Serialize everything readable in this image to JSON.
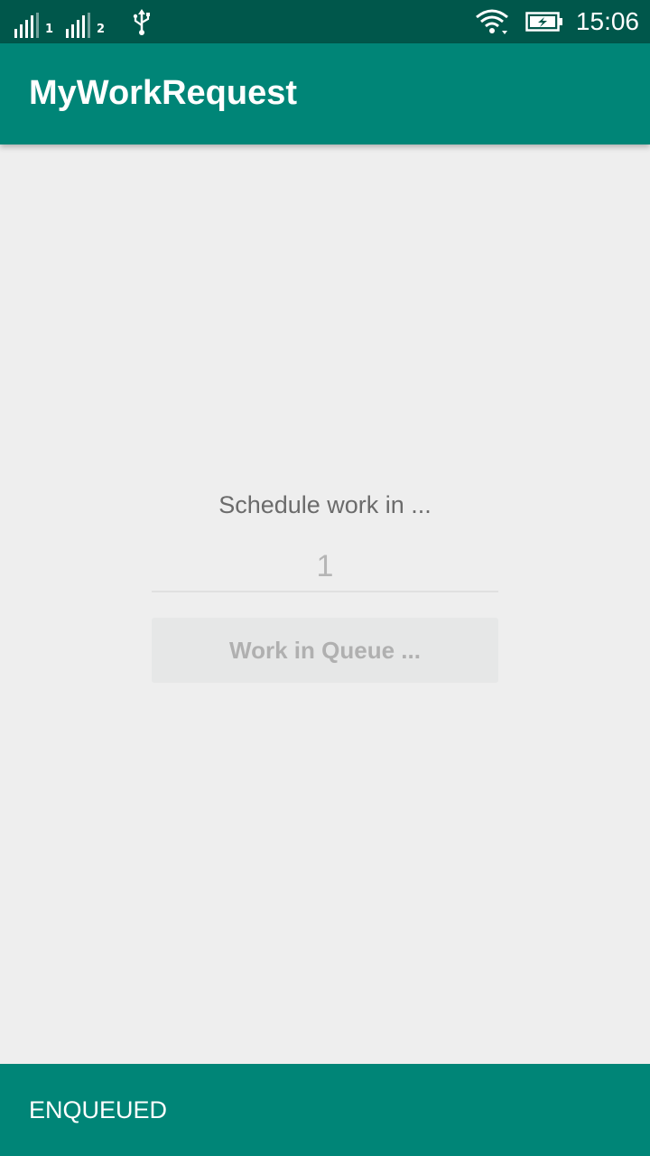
{
  "status_bar": {
    "sim1_label": "1",
    "sim2_label": "2",
    "time": "15:06",
    "icons": [
      "signal-icon",
      "usb-icon",
      "wifi-icon",
      "battery-charging-icon"
    ]
  },
  "app_bar": {
    "title": "MyWorkRequest",
    "color": "#008577"
  },
  "main": {
    "schedule_label": "Schedule work in ...",
    "count_value": "1",
    "button_label": "Work in Queue ..."
  },
  "bottom_bar": {
    "status_text": "ENQUEUED",
    "color": "#008577"
  }
}
